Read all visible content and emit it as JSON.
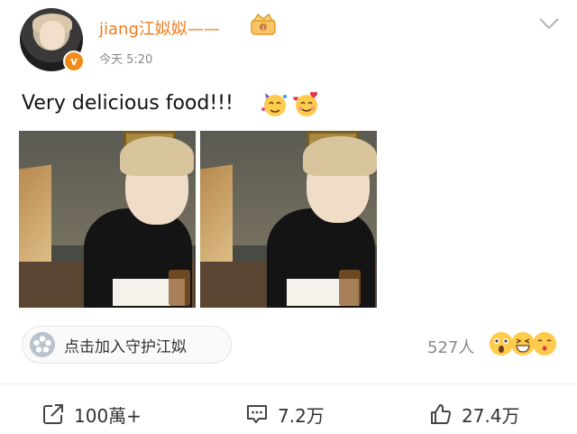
{
  "post": {
    "username": "jiang江姒姒——",
    "timestamp": "今天 5:20",
    "text": "Very delicious food!!!",
    "verified_badge": "v",
    "text_emojis": [
      "party-face",
      "smiling-face-with-hearts"
    ]
  },
  "guard": {
    "label": "点击加入守护江姒"
  },
  "supporters": {
    "count": "527人",
    "reactions": [
      "astonished-face",
      "grinning-squinting-face",
      "kissing-face"
    ]
  },
  "actions": {
    "share": "100萬+",
    "comment": "7.2万",
    "like": "27.4万"
  },
  "colors": {
    "username": "#ef7c1a",
    "badge": "#f08d19"
  }
}
